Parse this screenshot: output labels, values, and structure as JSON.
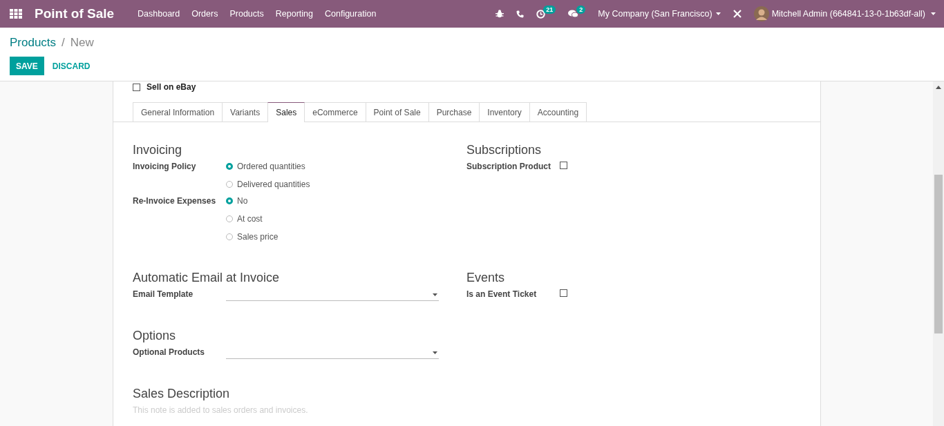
{
  "navbar": {
    "app_title": "Point of Sale",
    "menu": [
      "Dashboard",
      "Orders",
      "Products",
      "Reporting",
      "Configuration"
    ],
    "activity_count": "21",
    "message_count": "2",
    "company": "My Company (San Francisco)",
    "user": "Mitchell Admin (664841-13-0-1b63df-all)"
  },
  "breadcrumb": {
    "parent": "Products",
    "separator": "/",
    "current": "New"
  },
  "buttons": {
    "save": "SAVE",
    "discard": "DISCARD"
  },
  "sell_on_ebay": {
    "label": "Sell on eBay",
    "checked": false
  },
  "tabs": [
    {
      "label": "General Information",
      "selected": false
    },
    {
      "label": "Variants",
      "selected": false
    },
    {
      "label": "Sales",
      "selected": true
    },
    {
      "label": "eCommerce",
      "selected": false
    },
    {
      "label": "Point of Sale",
      "selected": false
    },
    {
      "label": "Purchase",
      "selected": false
    },
    {
      "label": "Inventory",
      "selected": false
    },
    {
      "label": "Accounting",
      "selected": false
    }
  ],
  "invoicing": {
    "title": "Invoicing",
    "groups": [
      {
        "label": "Invoicing Policy",
        "options": [
          {
            "label": "Ordered quantities",
            "selected": true
          },
          {
            "label": "Delivered quantities",
            "selected": false
          }
        ]
      },
      {
        "label": "Re-Invoice Expenses",
        "options": [
          {
            "label": "No",
            "selected": true
          },
          {
            "label": "At cost",
            "selected": false
          },
          {
            "label": "Sales price",
            "selected": false
          }
        ]
      }
    ]
  },
  "subscriptions": {
    "title": "Subscriptions",
    "label": "Subscription Product",
    "checked": false
  },
  "automatic_email": {
    "title": "Automatic Email at Invoice",
    "label": "Email Template"
  },
  "events": {
    "title": "Events",
    "label": "Is an Event Ticket",
    "checked": false
  },
  "options": {
    "title": "Options",
    "label": "Optional Products"
  },
  "sales_description": {
    "title": "Sales Description",
    "placeholder": "This note is added to sales orders and invoices."
  }
}
